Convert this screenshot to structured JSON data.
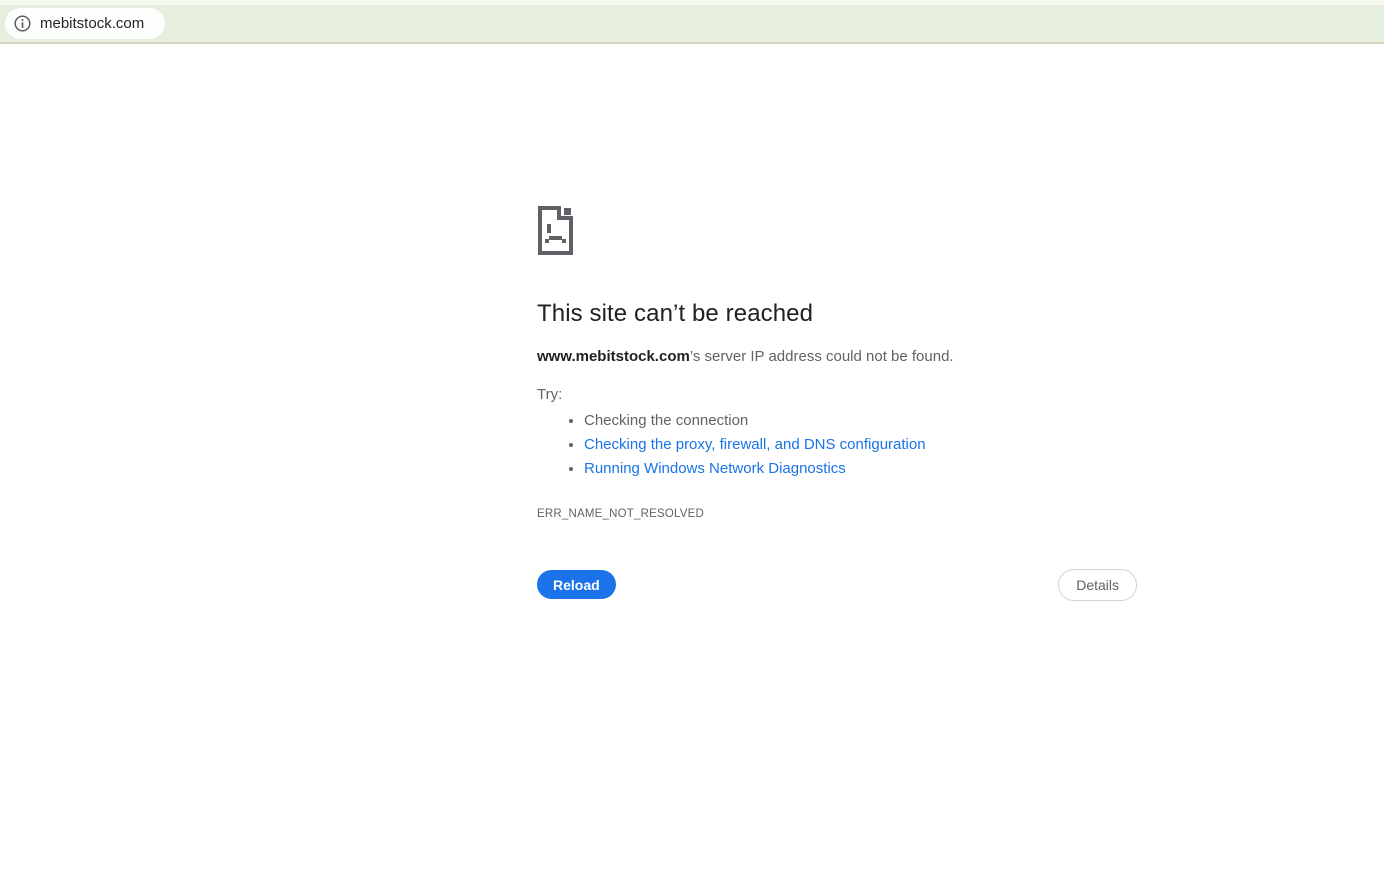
{
  "browser": {
    "url": "mebitstock.com",
    "info_icon": "info-icon"
  },
  "error_page": {
    "sad_file_icon": "sad-file-icon",
    "title": "This site can’t be reached",
    "host": "www.mebitstock.com",
    "message_rest": "’s server IP address could not be found.",
    "try_label": "Try:",
    "suggestions": [
      {
        "label": "Checking the connection",
        "is_link": false
      },
      {
        "label": "Checking the proxy, firewall, and DNS configuration",
        "is_link": true
      },
      {
        "label": "Running Windows Network Diagnostics",
        "is_link": true
      }
    ],
    "error_code": "ERR_NAME_NOT_RESOLVED",
    "reload_label": "Reload",
    "details_label": "Details"
  },
  "colors": {
    "accent_blue": "#1a73e8",
    "link_blue": "#1a73e8",
    "text_dark": "#202124",
    "text_gray": "#5f6368",
    "addressbar_bg": "#e6eedd",
    "addressbar_topstrip": "#f3f7ee",
    "url_pill_bg": "#fdfffc",
    "addressbar_border": "#d8d4c6",
    "details_border": "#d0d4d9",
    "icon_gray": "#5f6368"
  }
}
